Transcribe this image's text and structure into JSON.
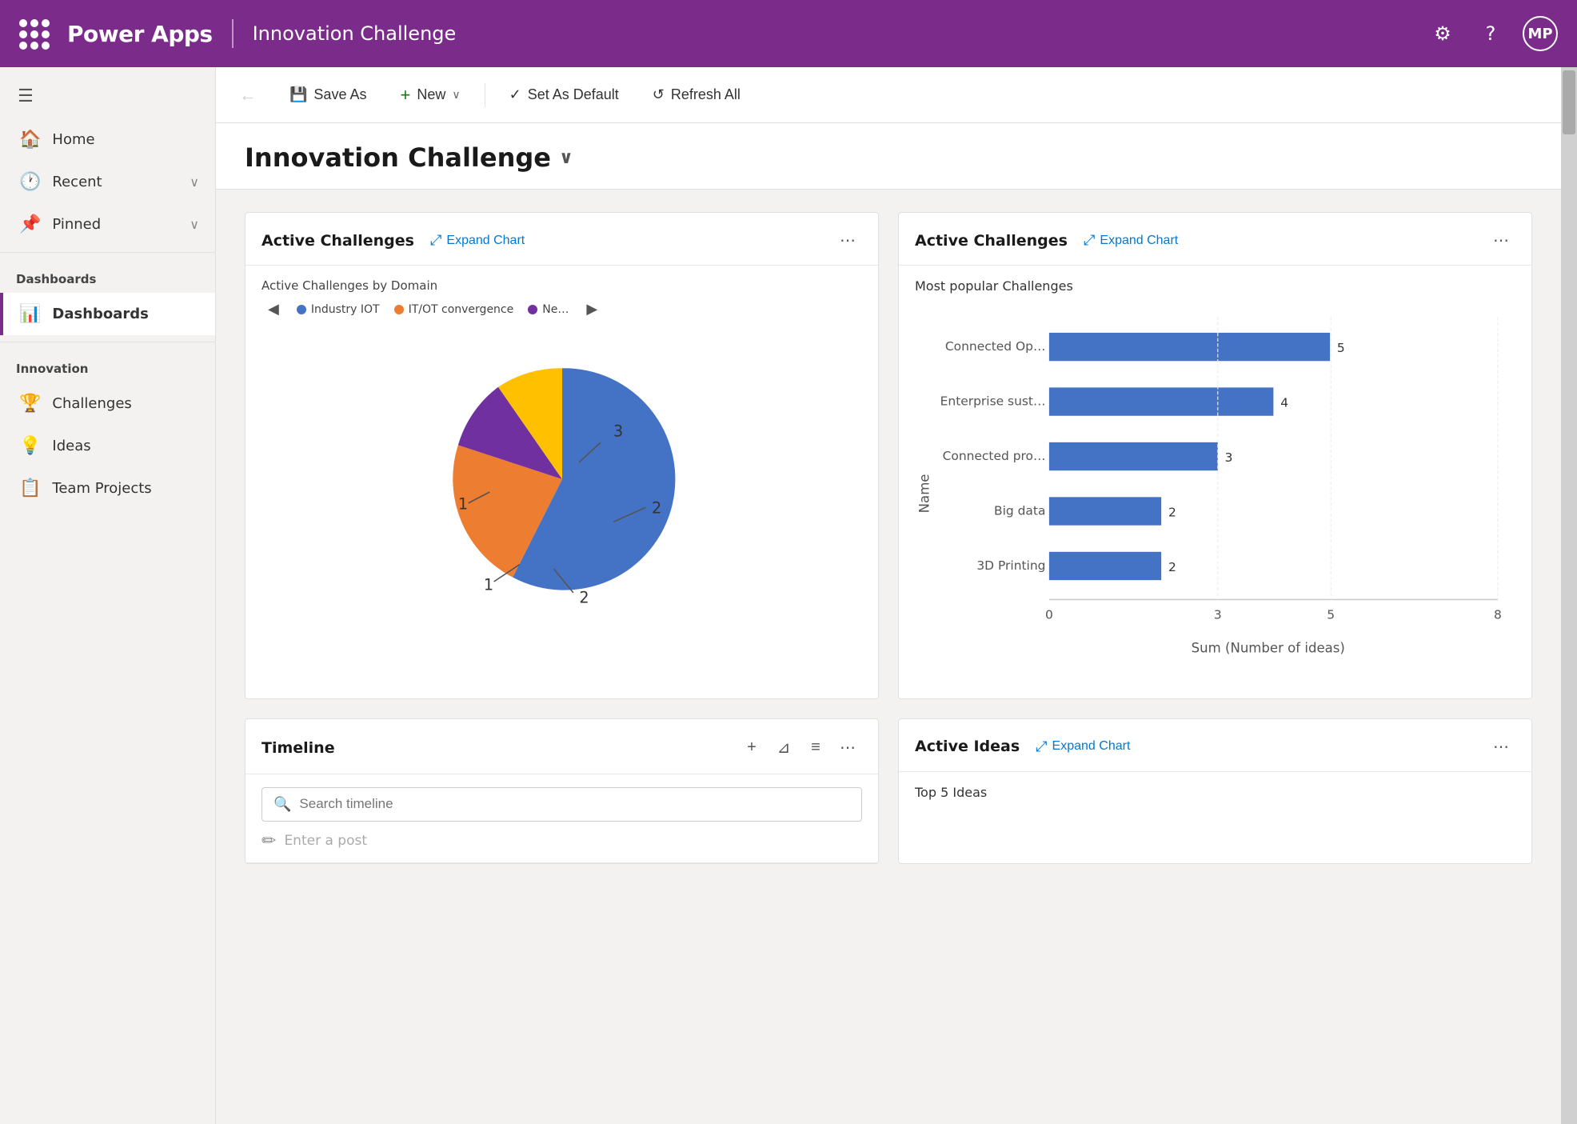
{
  "app": {
    "brand": "Power Apps",
    "page_title": "Innovation Challenge",
    "avatar_initials": "MP"
  },
  "toolbar": {
    "back_label": "←",
    "save_as_label": "Save As",
    "new_label": "New",
    "set_default_label": "Set As Default",
    "refresh_label": "Refresh All"
  },
  "sidebar": {
    "menu_sections": [
      {
        "label": "",
        "items": [
          {
            "id": "home",
            "label": "Home",
            "icon": "🏠",
            "has_arrow": false,
            "active": false
          },
          {
            "id": "recent",
            "label": "Recent",
            "icon": "🕐",
            "has_arrow": true,
            "active": false
          },
          {
            "id": "pinned",
            "label": "Pinned",
            "icon": "📌",
            "has_arrow": true,
            "active": false
          }
        ]
      },
      {
        "label": "Dashboards",
        "items": [
          {
            "id": "dashboards",
            "label": "Dashboards",
            "icon": "📊",
            "has_arrow": false,
            "active": true
          }
        ]
      },
      {
        "label": "Innovation",
        "items": [
          {
            "id": "challenges",
            "label": "Challenges",
            "icon": "🏆",
            "has_arrow": false,
            "active": false
          },
          {
            "id": "ideas",
            "label": "Ideas",
            "icon": "💡",
            "has_arrow": false,
            "active": false
          },
          {
            "id": "team-projects",
            "label": "Team Projects",
            "icon": "📋",
            "has_arrow": false,
            "active": false
          }
        ]
      }
    ]
  },
  "main": {
    "title": "Innovation Challenge",
    "cards": {
      "active_challenges_pie": {
        "title": "Active Challenges",
        "expand_label": "Expand Chart",
        "subtitle": "Active Challenges by Domain",
        "legend": [
          {
            "label": "Industry IOT",
            "color": "#4472C4"
          },
          {
            "label": "IT/OT convergence",
            "color": "#ED7D31"
          },
          {
            "label": "Ne…",
            "color": "#7030A0"
          }
        ],
        "pie_segments": [
          {
            "label": "3",
            "value": 3,
            "color": "#4472C4",
            "start": 0,
            "end": 180
          },
          {
            "label": "2",
            "value": 2,
            "color": "#ED7D31",
            "start": 180,
            "end": 288
          },
          {
            "label": "1",
            "value": 1,
            "color": "#7030A0",
            "start": 288,
            "end": 324
          },
          {
            "label": "1",
            "value": 1,
            "color": "#FFC000",
            "start": 324,
            "end": 360
          },
          {
            "label": "2",
            "value": 2,
            "color": "#5B9BD5",
            "start": 0,
            "end": 0
          }
        ]
      },
      "active_challenges_bar": {
        "title": "Active Challenges",
        "expand_label": "Expand Chart",
        "subtitle": "Most popular Challenges",
        "y_axis_label": "Name",
        "x_axis_label": "Sum (Number of ideas)",
        "x_ticks": [
          "0",
          "3",
          "5",
          "8"
        ],
        "bars": [
          {
            "label": "Connected Op…",
            "value": 5
          },
          {
            "label": "Enterprise sust…",
            "value": 4
          },
          {
            "label": "Connected pro…",
            "value": 3
          },
          {
            "label": "Big data",
            "value": 2
          },
          {
            "label": "3D Printing",
            "value": 2
          }
        ],
        "max_value": 8
      },
      "timeline": {
        "title": "Timeline",
        "search_placeholder": "Search timeline",
        "post_placeholder": "Enter a post"
      },
      "active_ideas": {
        "title": "Active Ideas",
        "expand_label": "Expand Chart",
        "subtitle": "Top 5 Ideas"
      }
    }
  }
}
